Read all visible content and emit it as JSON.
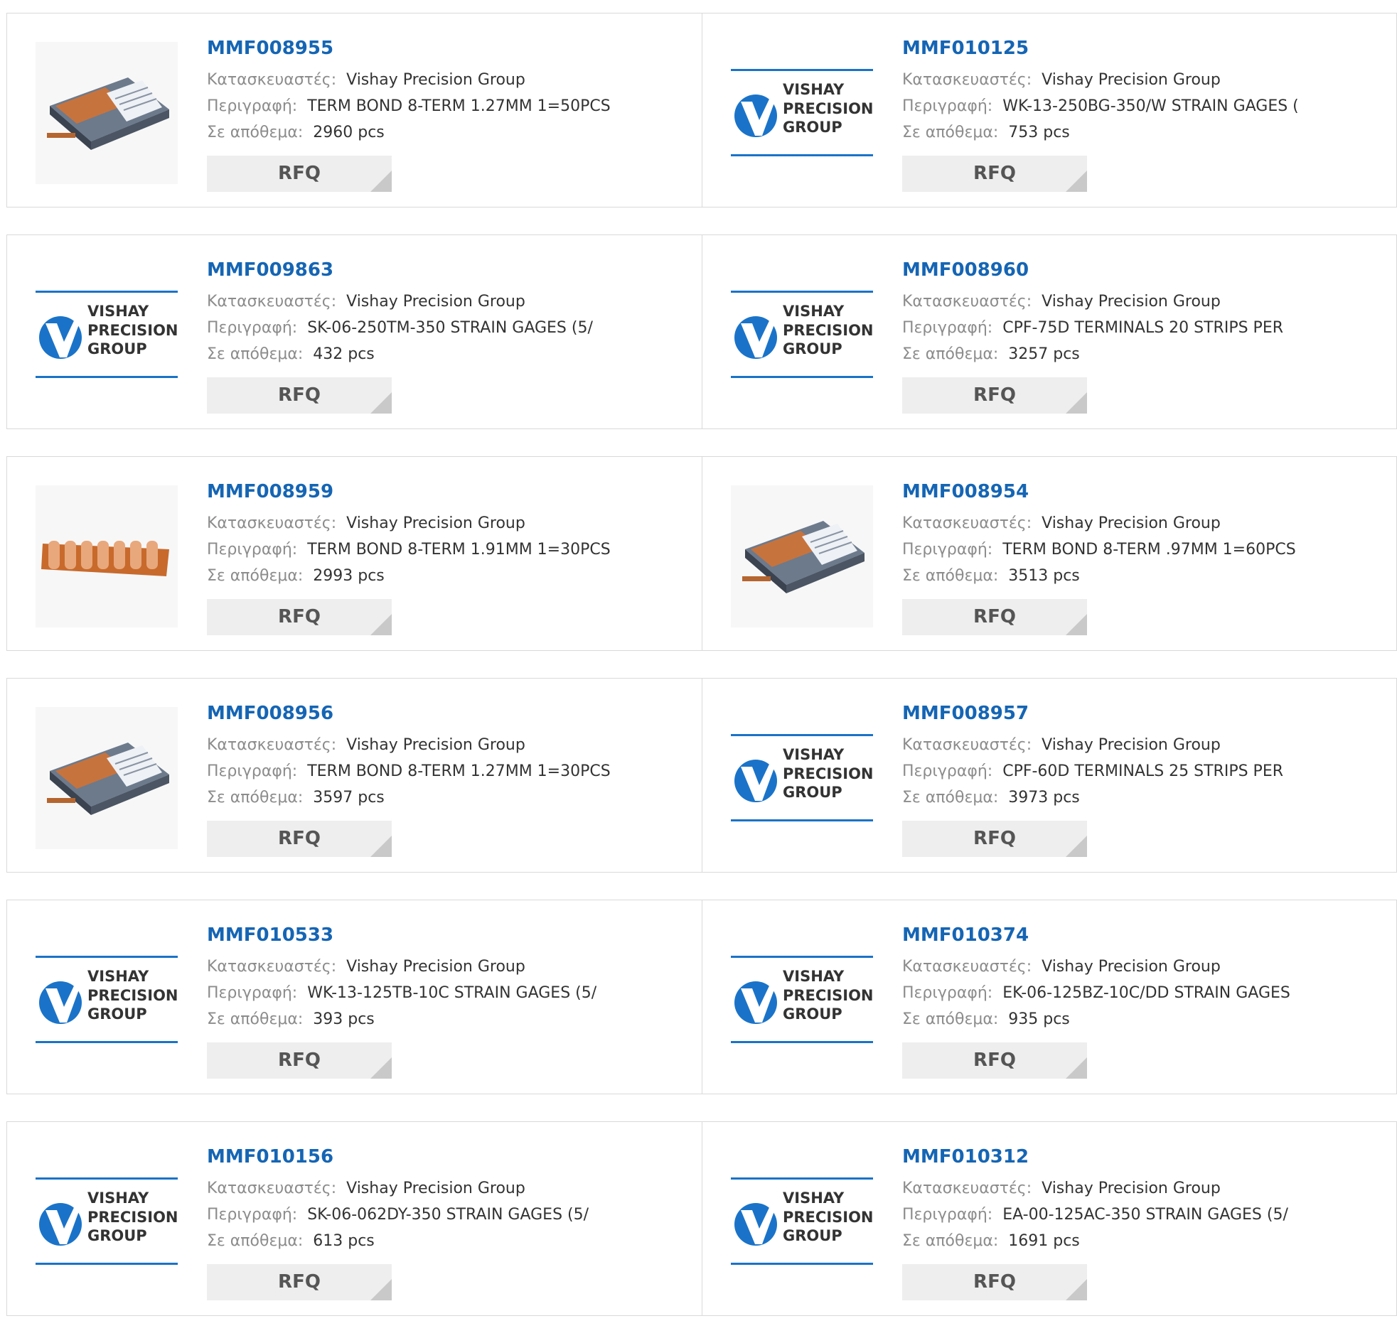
{
  "labels": {
    "manufacturer": "Κατασκευαστές:",
    "description": "Περιγραφή:",
    "stock": "Σε απόθεμα:",
    "rfq": "RFQ"
  },
  "products": [
    {
      "part": "MMF008955",
      "manufacturer": "Vishay Precision Group",
      "description": "TERM BOND 8-TERM 1.27MM 1=50PCS",
      "stock": "2960 pcs",
      "image": "box-icon"
    },
    {
      "part": "MMF010125",
      "manufacturer": "Vishay Precision Group",
      "description": "WK-13-250BG-350/W STRAIN GAGES (",
      "stock": "753 pcs",
      "image": "vpg-logo"
    },
    {
      "part": "MMF009863",
      "manufacturer": "Vishay Precision Group",
      "description": "SK-06-250TM-350 STRAIN GAGES (5/",
      "stock": "432 pcs",
      "image": "vpg-logo"
    },
    {
      "part": "MMF008960",
      "manufacturer": "Vishay Precision Group",
      "description": "CPF-75D TERMINALS 20 STRIPS PER",
      "stock": "3257 pcs",
      "image": "vpg-logo"
    },
    {
      "part": "MMF008959",
      "manufacturer": "Vishay Precision Group",
      "description": "TERM BOND 8-TERM 1.91MM 1=30PCS",
      "stock": "2993 pcs",
      "image": "strip-icon"
    },
    {
      "part": "MMF008954",
      "manufacturer": "Vishay Precision Group",
      "description": "TERM BOND 8-TERM .97MM 1=60PCS",
      "stock": "3513 pcs",
      "image": "box-icon"
    },
    {
      "part": "MMF008956",
      "manufacturer": "Vishay Precision Group",
      "description": "TERM BOND 8-TERM 1.27MM 1=30PCS",
      "stock": "3597 pcs",
      "image": "box-icon"
    },
    {
      "part": "MMF008957",
      "manufacturer": "Vishay Precision Group",
      "description": "CPF-60D TERMINALS 25 STRIPS PER",
      "stock": "3973 pcs",
      "image": "vpg-logo"
    },
    {
      "part": "MMF010533",
      "manufacturer": "Vishay Precision Group",
      "description": "WK-13-125TB-10C STRAIN GAGES (5/",
      "stock": "393 pcs",
      "image": "vpg-logo"
    },
    {
      "part": "MMF010374",
      "manufacturer": "Vishay Precision Group",
      "description": "EK-06-125BZ-10C/DD STRAIN GAGES",
      "stock": "935 pcs",
      "image": "vpg-logo"
    },
    {
      "part": "MMF010156",
      "manufacturer": "Vishay Precision Group",
      "description": "SK-06-062DY-350 STRAIN GAGES (5/",
      "stock": "613 pcs",
      "image": "vpg-logo"
    },
    {
      "part": "MMF010312",
      "manufacturer": "Vishay Precision Group",
      "description": "EA-00-125AC-350 STRAIN GAGES (5/",
      "stock": "1691 pcs",
      "image": "vpg-logo"
    }
  ],
  "logo": {
    "line1": "VISHAY",
    "line2": "PRECISION",
    "line3": "GROUP",
    "blue": "#1a73c8",
    "text": "#333333"
  },
  "colors": {
    "part_link": "#1565b4",
    "label": "#8c8c8c",
    "rfq_bg": "#eeeeee",
    "border": "#d9d9d9"
  }
}
